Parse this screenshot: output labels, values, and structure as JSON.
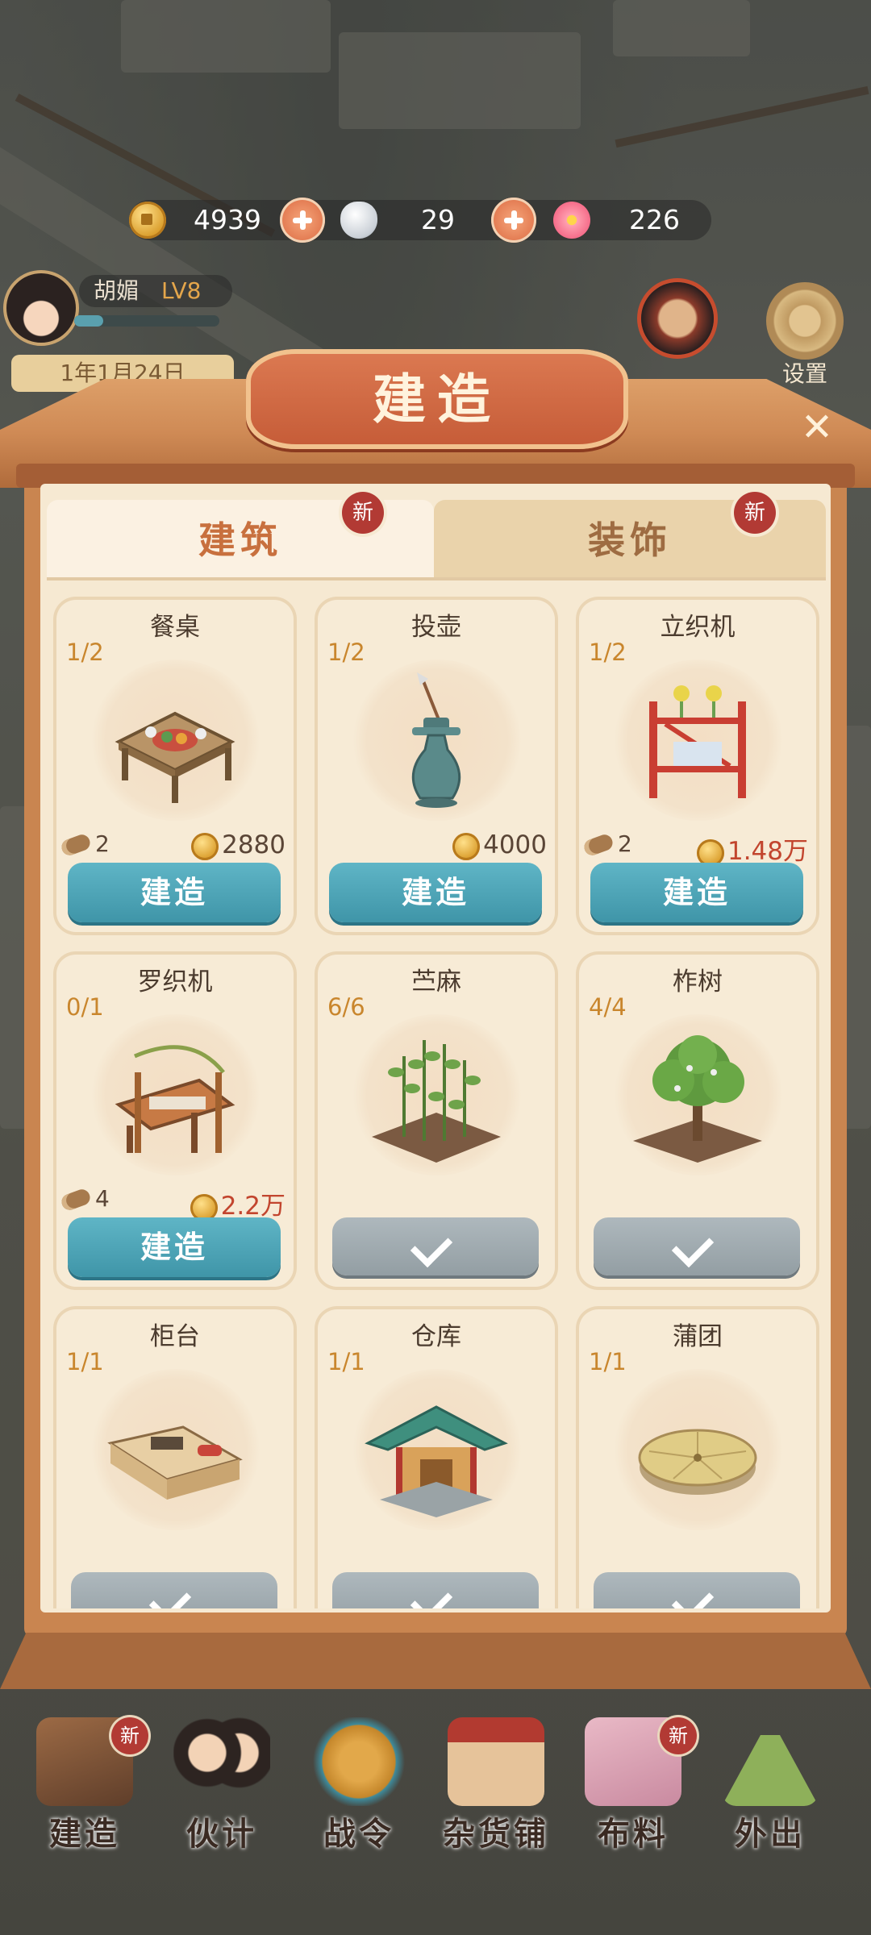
{
  "resources": {
    "coins": "4939",
    "silver": "29",
    "blossom": "226"
  },
  "player": {
    "name": "胡媚",
    "level": "LV8",
    "date": "1年1月24日",
    "xp_fraction": 0.2
  },
  "settings_label": "设置",
  "panel": {
    "title": "建造",
    "tabs": [
      {
        "label": "建筑",
        "badge": "新"
      },
      {
        "label": "装饰",
        "badge": "新"
      }
    ]
  },
  "items": [
    {
      "name": "餐桌",
      "count": "1/2",
      "wood": "2",
      "cost": "2880",
      "cost_red": false,
      "state": "build",
      "button": "建造"
    },
    {
      "name": "投壶",
      "count": "1/2",
      "wood": "",
      "cost": "4000",
      "cost_red": false,
      "state": "build",
      "button": "建造"
    },
    {
      "name": "立织机",
      "count": "1/2",
      "wood": "2",
      "cost": "1.48万",
      "cost_red": true,
      "state": "build",
      "button": "建造"
    },
    {
      "name": "罗织机",
      "count": "0/1",
      "wood": "4",
      "cost": "2.2万",
      "cost_red": true,
      "state": "build",
      "button": "建造"
    },
    {
      "name": "苎麻",
      "count": "6/6",
      "wood": "",
      "cost": "",
      "state": "done",
      "button": ""
    },
    {
      "name": "柞树",
      "count": "4/4",
      "wood": "",
      "cost": "",
      "state": "done",
      "button": ""
    },
    {
      "name": "柜台",
      "count": "1/1",
      "wood": "",
      "cost": "",
      "state": "done",
      "button": ""
    },
    {
      "name": "仓库",
      "count": "1/1",
      "wood": "",
      "cost": "",
      "state": "done",
      "button": ""
    },
    {
      "name": "蒲团",
      "count": "1/1",
      "wood": "",
      "cost": "",
      "state": "done",
      "button": ""
    }
  ],
  "nav": [
    {
      "label": "建造",
      "badge": "新"
    },
    {
      "label": "伙计",
      "badge": ""
    },
    {
      "label": "战令",
      "badge": ""
    },
    {
      "label": "杂货铺",
      "badge": ""
    },
    {
      "label": "布料",
      "badge": "新"
    },
    {
      "label": "外出",
      "badge": ""
    }
  ],
  "colors": {
    "build_button": "#4aa3b5",
    "panel_bg": "#f6e9d2",
    "title_plaque": "#c95f3a",
    "count_text": "#c9862d",
    "cost_red": "#c2452e"
  }
}
